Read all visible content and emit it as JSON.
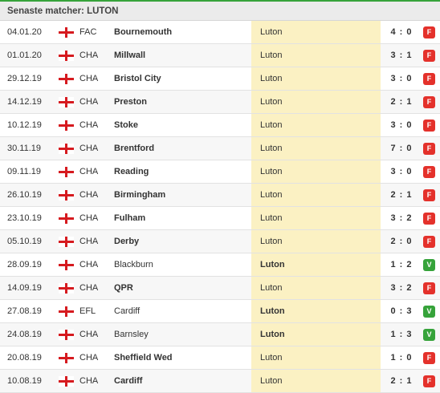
{
  "header": {
    "title": "Senaste matcher: LUTON"
  },
  "colors": {
    "accent_green": "#36a33a",
    "loss_red": "#e4312b",
    "win_green": "#36a33a",
    "highlight": "#fbf1c3"
  },
  "matches": [
    {
      "date": "04.01.20",
      "flag": "england-flag-icon",
      "comp": "FAC",
      "home": "Bournemouth",
      "away": "Luton",
      "score": "4 : 0",
      "result": "F",
      "winner": "home"
    },
    {
      "date": "01.01.20",
      "flag": "england-flag-icon",
      "comp": "CHA",
      "home": "Millwall",
      "away": "Luton",
      "score": "3 : 1",
      "result": "F",
      "winner": "home"
    },
    {
      "date": "29.12.19",
      "flag": "england-flag-icon",
      "comp": "CHA",
      "home": "Bristol City",
      "away": "Luton",
      "score": "3 : 0",
      "result": "F",
      "winner": "home"
    },
    {
      "date": "14.12.19",
      "flag": "england-flag-icon",
      "comp": "CHA",
      "home": "Preston",
      "away": "Luton",
      "score": "2 : 1",
      "result": "F",
      "winner": "home"
    },
    {
      "date": "10.12.19",
      "flag": "england-flag-icon",
      "comp": "CHA",
      "home": "Stoke",
      "away": "Luton",
      "score": "3 : 0",
      "result": "F",
      "winner": "home"
    },
    {
      "date": "30.11.19",
      "flag": "england-flag-icon",
      "comp": "CHA",
      "home": "Brentford",
      "away": "Luton",
      "score": "7 : 0",
      "result": "F",
      "winner": "home"
    },
    {
      "date": "09.11.19",
      "flag": "england-flag-icon",
      "comp": "CHA",
      "home": "Reading",
      "away": "Luton",
      "score": "3 : 0",
      "result": "F",
      "winner": "home"
    },
    {
      "date": "26.10.19",
      "flag": "england-flag-icon",
      "comp": "CHA",
      "home": "Birmingham",
      "away": "Luton",
      "score": "2 : 1",
      "result": "F",
      "winner": "home"
    },
    {
      "date": "23.10.19",
      "flag": "england-flag-icon",
      "comp": "CHA",
      "home": "Fulham",
      "away": "Luton",
      "score": "3 : 2",
      "result": "F",
      "winner": "home"
    },
    {
      "date": "05.10.19",
      "flag": "england-flag-icon",
      "comp": "CHA",
      "home": "Derby",
      "away": "Luton",
      "score": "2 : 0",
      "result": "F",
      "winner": "home"
    },
    {
      "date": "28.09.19",
      "flag": "england-flag-icon",
      "comp": "CHA",
      "home": "Blackburn",
      "away": "Luton",
      "score": "1 : 2",
      "result": "V",
      "winner": "away"
    },
    {
      "date": "14.09.19",
      "flag": "england-flag-icon",
      "comp": "CHA",
      "home": "QPR",
      "away": "Luton",
      "score": "3 : 2",
      "result": "F",
      "winner": "home"
    },
    {
      "date": "27.08.19",
      "flag": "england-flag-icon",
      "comp": "EFL",
      "home": "Cardiff",
      "away": "Luton",
      "score": "0 : 3",
      "result": "V",
      "winner": "away"
    },
    {
      "date": "24.08.19",
      "flag": "england-flag-icon",
      "comp": "CHA",
      "home": "Barnsley",
      "away": "Luton",
      "score": "1 : 3",
      "result": "V",
      "winner": "away"
    },
    {
      "date": "20.08.19",
      "flag": "england-flag-icon",
      "comp": "CHA",
      "home": "Sheffield Wed",
      "away": "Luton",
      "score": "1 : 0",
      "result": "F",
      "winner": "home"
    },
    {
      "date": "10.08.19",
      "flag": "england-flag-icon",
      "comp": "CHA",
      "home": "Cardiff",
      "away": "Luton",
      "score": "2 : 1",
      "result": "F",
      "winner": "home"
    }
  ]
}
